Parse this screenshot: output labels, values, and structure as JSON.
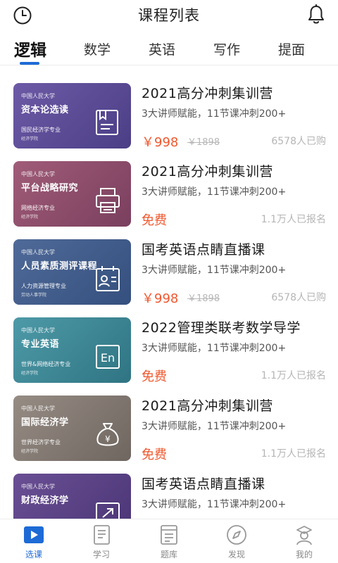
{
  "header": {
    "title": "课程列表",
    "left_icon": "clock-icon",
    "right_icon": "bell-icon"
  },
  "tabs": [
    {
      "label": "逻辑",
      "active": true
    },
    {
      "label": "数学",
      "active": false
    },
    {
      "label": "英语",
      "active": false
    },
    {
      "label": "写作",
      "active": false
    },
    {
      "label": "提面",
      "active": false
    }
  ],
  "courses": [
    {
      "cover": {
        "school": "中国人民大学",
        "title": "资本论选读",
        "major": "国民经济学专业",
        "college": "经济学院",
        "icon": "book-icon",
        "color_from": "#6d5aa6",
        "color_to": "#4b3e86"
      },
      "name": "2021高分冲刺集训营",
      "desc": "3大讲师赋能，11节课冲刺200+",
      "price": "￥998",
      "original_price": "￥1898",
      "enroll": "6578人已购"
    },
    {
      "cover": {
        "school": "中国人民大学",
        "title": "平台战略研究",
        "major": "网络经济专业",
        "college": "经济学院",
        "icon": "printer-icon",
        "color_from": "#a05c78",
        "color_to": "#7a3f5e"
      },
      "name": "2021高分冲刺集训营",
      "desc": "3大讲师赋能，11节课冲刺200+",
      "price": "免费",
      "original_price": "",
      "enroll": "1.1万人已报名"
    },
    {
      "cover": {
        "school": "中国人民大学",
        "title": "人员素质测评课程",
        "major": "人力资源管理专业",
        "college": "劳动人事学院",
        "icon": "calendar-person-icon",
        "color_from": "#4f6a98",
        "color_to": "#35507e"
      },
      "name": "国考英语点睛直播课",
      "desc": "3大讲师赋能，11节课冲刺200+",
      "price": "￥998",
      "original_price": "￥1898",
      "enroll": "6578人已购"
    },
    {
      "cover": {
        "school": "中国人民大学",
        "title": "专业英语",
        "major": "世界&网络经济专业",
        "college": "经济学院",
        "icon": "en-icon",
        "color_from": "#4e9aa8",
        "color_to": "#2f7482"
      },
      "name": "2022管理类联考数学导学",
      "desc": "3大讲师赋能，11节课冲刺200+",
      "price": "免费",
      "original_price": "",
      "enroll": "1.1万人已报名"
    },
    {
      "cover": {
        "school": "中国人民大学",
        "title": "国际经济学",
        "major": "世界经济学专业",
        "college": "经济学院",
        "icon": "money-bag-icon",
        "color_from": "#968c84",
        "color_to": "#6f6660"
      },
      "name": "2021高分冲刺集训营",
      "desc": "3大讲师赋能，11节课冲刺200+",
      "price": "免费",
      "original_price": "",
      "enroll": "1.1万人已报名"
    },
    {
      "cover": {
        "school": "中国人民大学",
        "title": "财政经济学",
        "major": "",
        "college": "",
        "icon": "arrow-box-icon",
        "color_from": "#6a4f94",
        "color_to": "#4a3576"
      },
      "name": "国考英语点睛直播课",
      "desc": "3大讲师赋能，11节课冲刺200+",
      "price": "",
      "original_price": "",
      "enroll": ""
    }
  ],
  "bottom_nav": [
    {
      "label": "选课",
      "icon": "play-icon",
      "active": true
    },
    {
      "label": "学习",
      "icon": "notebook-icon",
      "active": false
    },
    {
      "label": "题库",
      "icon": "document-icon",
      "active": false
    },
    {
      "label": "发现",
      "icon": "compass-icon",
      "active": false
    },
    {
      "label": "我的",
      "icon": "profile-icon",
      "active": false
    }
  ],
  "colors": {
    "accent": "#1e6bd6",
    "price": "#f0582e",
    "muted": "#b5b5b5"
  }
}
